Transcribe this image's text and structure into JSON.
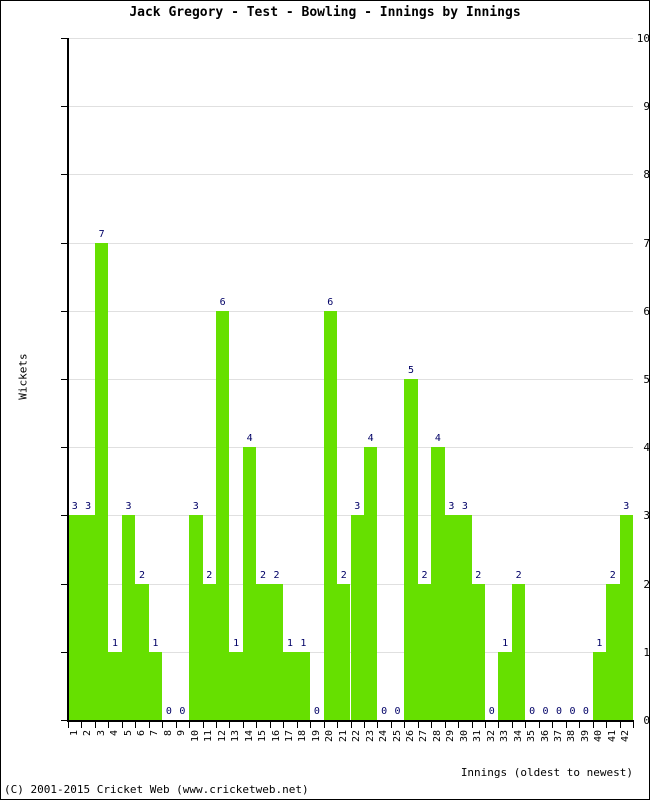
{
  "chart_data": {
    "type": "bar",
    "title": "Jack Gregory - Test - Bowling - Innings by Innings",
    "xlabel": "Innings (oldest to newest)",
    "ylabel": "Wickets",
    "categories": [
      "1",
      "2",
      "3",
      "4",
      "5",
      "6",
      "7",
      "8",
      "9",
      "10",
      "11",
      "12",
      "13",
      "14",
      "15",
      "16",
      "17",
      "18",
      "19",
      "20",
      "21",
      "22",
      "23",
      "24",
      "25",
      "26",
      "27",
      "28",
      "29",
      "30",
      "31",
      "32",
      "33",
      "34",
      "35",
      "36",
      "37",
      "38",
      "39",
      "40",
      "41",
      "42"
    ],
    "values": [
      3,
      3,
      7,
      1,
      3,
      2,
      1,
      0,
      0,
      3,
      2,
      6,
      1,
      4,
      2,
      2,
      1,
      1,
      0,
      6,
      2,
      3,
      4,
      0,
      0,
      5,
      2,
      4,
      3,
      3,
      2,
      0,
      1,
      2,
      0,
      0,
      0,
      0,
      0,
      1,
      2,
      3
    ],
    "ylim": [
      0,
      10
    ],
    "yticks": [
      0,
      1,
      2,
      3,
      4,
      5,
      6,
      7,
      8,
      9,
      10
    ],
    "grid": true,
    "legend": "none",
    "bar_color": "#66e000",
    "label_color": "#000066",
    "grid_color": "#e0e0e0",
    "axis_color": "#000000",
    "show_value_labels": true
  },
  "footer": {
    "copyright": "(C) 2001-2015 Cricket Web (www.cricketweb.net)"
  }
}
